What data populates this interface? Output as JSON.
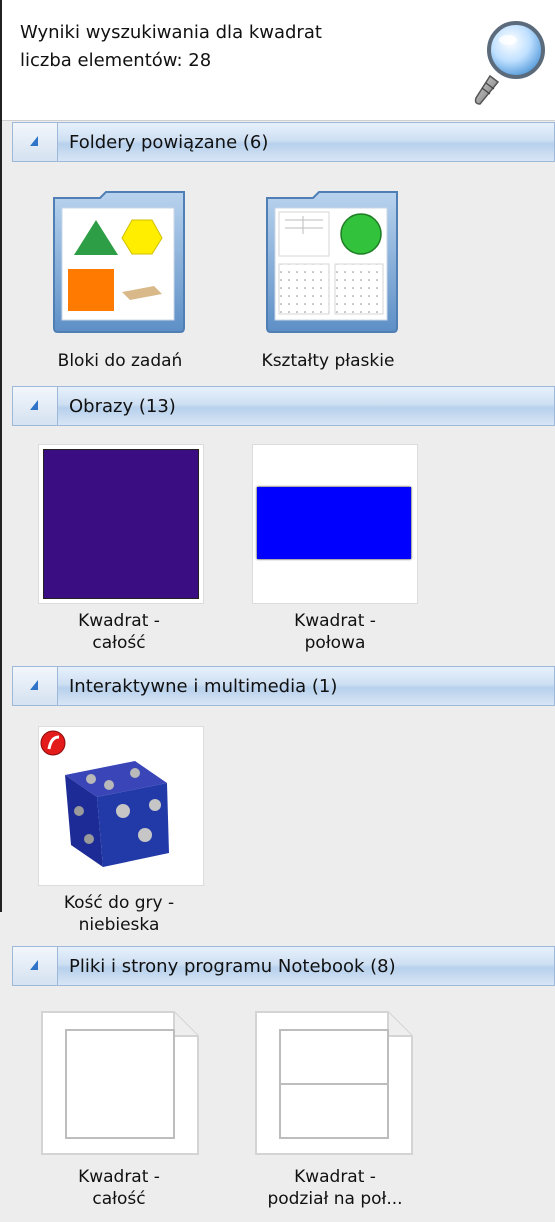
{
  "header": {
    "line1": "Wyniki wyszukiwania dla kwadrat",
    "line2": "liczba elementów: 28"
  },
  "sections": [
    {
      "title": "Foldery powiązane (6)"
    },
    {
      "title": "Obrazy (13)"
    },
    {
      "title": "Interaktywne i multimedia (1)"
    },
    {
      "title": "Pliki i strony programu Notebook (8)"
    }
  ],
  "folders": [
    {
      "caption": "Bloki do zadań"
    },
    {
      "caption": "Kształty płaskie"
    }
  ],
  "images": [
    {
      "line1": "Kwadrat -",
      "line2": "całość",
      "color": "#3a0e82"
    },
    {
      "line1": "Kwadrat -",
      "line2": "połowa",
      "color": "#0000ff"
    }
  ],
  "interactive": [
    {
      "line1": "Kość do gry -",
      "line2": "niebieska"
    }
  ],
  "notebook": [
    {
      "line1": "Kwadrat -",
      "line2": "całość"
    },
    {
      "line1": "Kwadrat -",
      "line2": "podział na poł..."
    }
  ],
  "colors": {
    "accent": "#2f74c8",
    "green": "#2e9e46",
    "yellow": "#ffee00",
    "orange": "#ff7a00",
    "flash_red": "#e31b1b"
  }
}
